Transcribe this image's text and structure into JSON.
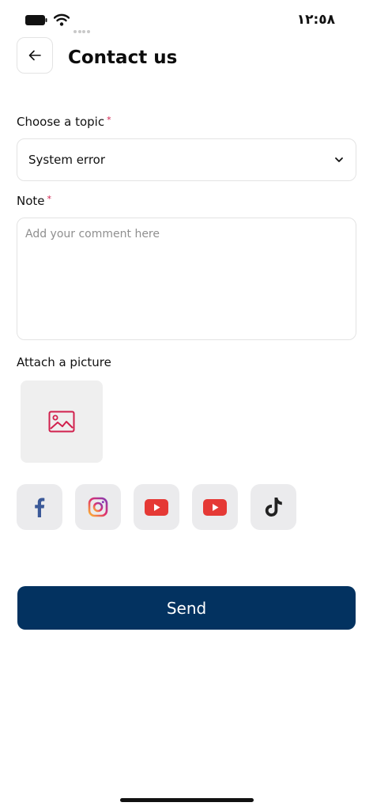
{
  "status_bar": {
    "time": "١٢:٥٨"
  },
  "header": {
    "title": "Contact us"
  },
  "form": {
    "topic_label": "Choose a topic",
    "topic_required": "*",
    "topic_value": "System error",
    "note_label": "Note",
    "note_required": "*",
    "note_placeholder": "Add your comment here",
    "note_value": "",
    "attach_label": "Attach a picture"
  },
  "social": [
    {
      "name": "facebook-icon",
      "color": "#3b5998"
    },
    {
      "name": "instagram-icon",
      "color": "#d6249f"
    },
    {
      "name": "youtube-icon",
      "color": "#e53935"
    },
    {
      "name": "youtube-icon",
      "color": "#e53935"
    },
    {
      "name": "tiktok-icon",
      "color": "#222222"
    }
  ],
  "actions": {
    "send_label": "Send"
  },
  "colors": {
    "primary": "#033260",
    "required": "#d1204d",
    "picture_icon": "#d1204d"
  }
}
